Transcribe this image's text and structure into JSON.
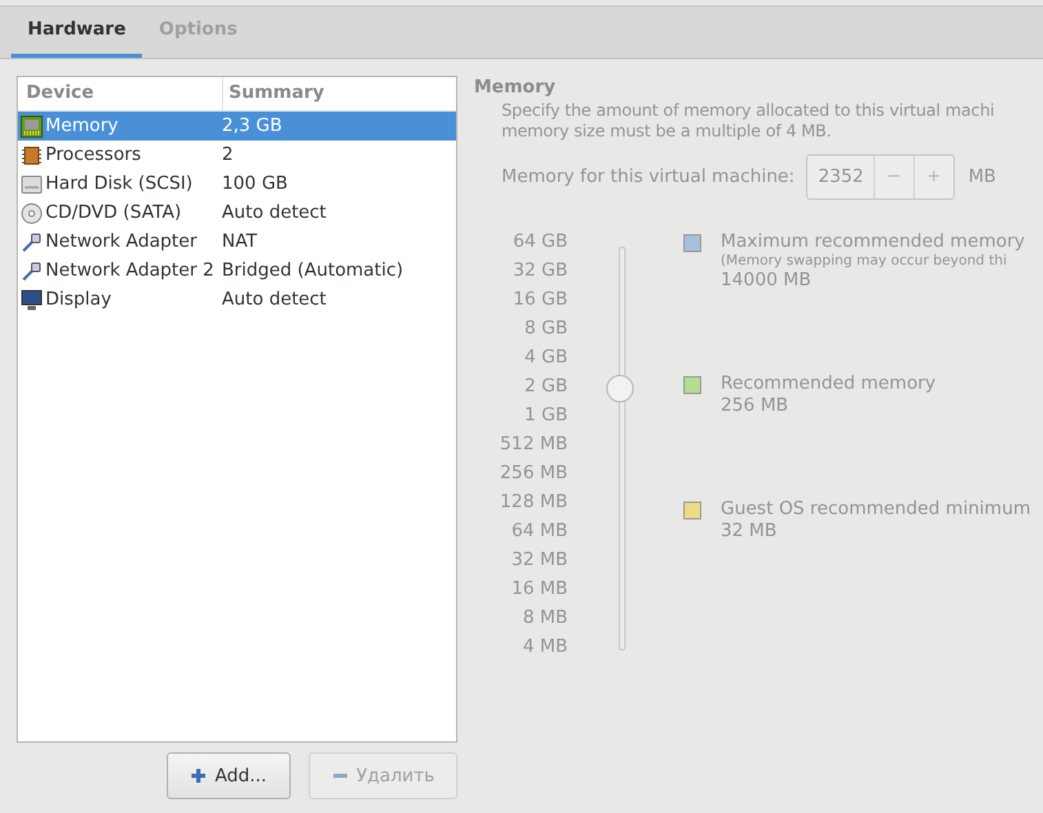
{
  "tabs": [
    {
      "label": "Hardware",
      "selected": true
    },
    {
      "label": "Options",
      "selected": false
    }
  ],
  "devices": {
    "columns": [
      "Device",
      "Summary"
    ],
    "rows": [
      {
        "kind": "memory",
        "name": "Memory",
        "summary": "2,3 GB",
        "selected": true
      },
      {
        "kind": "cpu",
        "name": "Processors",
        "summary": "2",
        "selected": false
      },
      {
        "kind": "disk",
        "name": "Hard Disk (SCSI)",
        "summary": "100 GB",
        "selected": false
      },
      {
        "kind": "cd",
        "name": "CD/DVD (SATA)",
        "summary": "Auto detect",
        "selected": false
      },
      {
        "kind": "network",
        "name": "Network Adapter",
        "summary": "NAT",
        "selected": false
      },
      {
        "kind": "network",
        "name": "Network Adapter 2",
        "summary": "Bridged (Automatic)",
        "selected": false
      },
      {
        "kind": "display",
        "name": "Display",
        "summary": "Auto detect",
        "selected": false
      }
    ]
  },
  "buttons": [
    {
      "kind": "add",
      "label": "Add...",
      "disabled": false
    },
    {
      "kind": "remove",
      "label": "Удалить",
      "disabled": true
    }
  ],
  "memory": {
    "title": "Memory",
    "description_1": "Specify the amount of memory allocated to this virtual machi",
    "description_2": "memory size must be a multiple of 4 MB.",
    "field_label": "Memory for this virtual machine:",
    "value": "2352",
    "decrement": "−",
    "increment": "+",
    "unit": "MB",
    "scale": [
      "64 GB",
      "32 GB",
      "16 GB",
      "8 GB",
      "4 GB",
      "2 GB",
      "1 GB",
      "512 MB",
      "256 MB",
      "128 MB",
      "64 MB",
      "32 MB",
      "16 MB",
      "8 MB",
      "4 MB"
    ],
    "level": 0.65,
    "legend": [
      {
        "color": "#a9c0dc",
        "label": "Maximum recommended memory",
        "note": "(Memory swapping may occur beyond thi",
        "value": "14000 MB"
      },
      {
        "color": "#b6dc8f",
        "label": "Recommended memory",
        "value": "256 MB"
      },
      {
        "color": "#e9dd88",
        "label": "Guest OS recommended minimum",
        "value": "32 MB"
      }
    ]
  }
}
